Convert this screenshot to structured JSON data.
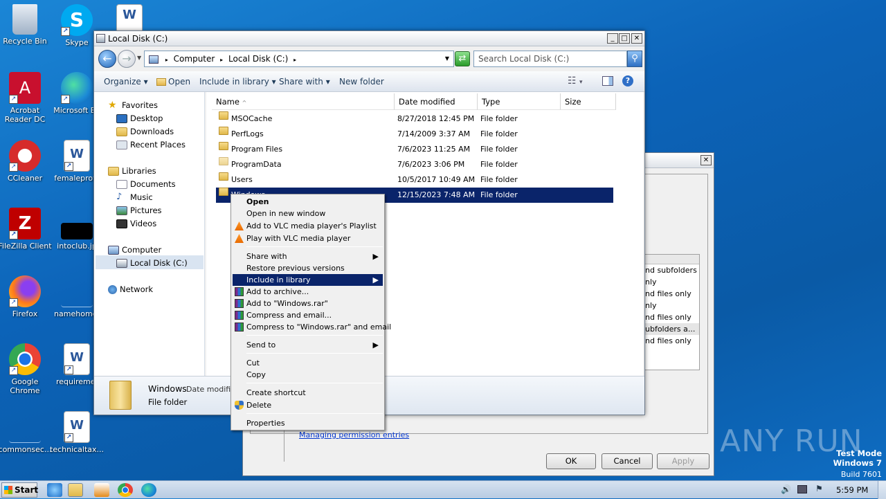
{
  "desktop": {
    "icons": [
      {
        "label": "Recycle Bin"
      },
      {
        "label": "Skype"
      },
      {
        "label": "Acrobat Reader DC"
      },
      {
        "label": "Microsoft Ed"
      },
      {
        "label": "CCleaner"
      },
      {
        "label": "femaleprovi"
      },
      {
        "label": "FileZilla Client"
      },
      {
        "label": "intoclub.jp"
      },
      {
        "label": "Firefox"
      },
      {
        "label": "namehome."
      },
      {
        "label": "Google Chrome"
      },
      {
        "label": "requireme."
      },
      {
        "label": "commonsec..."
      },
      {
        "label": "technicaltax..."
      }
    ]
  },
  "explorer": {
    "title": "Local Disk (C:)",
    "breadcrumb": [
      "Computer",
      "Local Disk (C:)"
    ],
    "search_placeholder": "Search Local Disk (C:)",
    "toolbar": {
      "organize": "Organize",
      "open": "Open",
      "include": "Include in library",
      "share": "Share with",
      "new_folder": "New folder"
    },
    "nav": {
      "favorites": "Favorites",
      "desktop": "Desktop",
      "downloads": "Downloads",
      "recent": "Recent Places",
      "libraries": "Libraries",
      "documents": "Documents",
      "music": "Music",
      "pictures": "Pictures",
      "videos": "Videos",
      "computer": "Computer",
      "local_disk": "Local Disk (C:)",
      "network": "Network"
    },
    "columns": {
      "name": "Name",
      "date": "Date modified",
      "type": "Type",
      "size": "Size"
    },
    "rows": [
      {
        "name": "MSOCache",
        "date": "8/27/2018 12:45 PM",
        "type": "File folder"
      },
      {
        "name": "PerfLogs",
        "date": "7/14/2009 3:37 AM",
        "type": "File folder"
      },
      {
        "name": "Program Files",
        "date": "7/6/2023 11:25 AM",
        "type": "File folder"
      },
      {
        "name": "ProgramData",
        "date": "7/6/2023 3:06 PM",
        "type": "File folder"
      },
      {
        "name": "Users",
        "date": "10/5/2017 10:49 AM",
        "type": "File folder"
      },
      {
        "name": "Windows",
        "date": "12/15/2023 7:48 AM",
        "type": "File folder"
      }
    ],
    "details": {
      "name": "Windows",
      "date_label": "Date modified",
      "type": "File folder"
    }
  },
  "context_menu": {
    "open": "Open",
    "open_new": "Open in new window",
    "vlc_add": "Add to VLC media player's Playlist",
    "vlc_play": "Play with VLC media player",
    "share": "Share with",
    "restore": "Restore previous versions",
    "include": "Include in library",
    "add_archive": "Add to archive...",
    "add_rar": "Add to \"Windows.rar\"",
    "compress_email": "Compress and email...",
    "compress_rar_email": "Compress to \"Windows.rar\" and email",
    "send_to": "Send to",
    "cut": "Cut",
    "copy": "Copy",
    "shortcut": "Create shortcut",
    "delete": "Delete",
    "properties": "Properties"
  },
  "bg_dialog": {
    "items": [
      "nd subfolders",
      "nly",
      "nd files only",
      "nly",
      "nd files only",
      "ubfolders a...",
      "nd files only"
    ],
    "link_text": "Managing permission entries",
    "ok": "OK",
    "cancel": "Cancel",
    "apply": "Apply"
  },
  "watermark": {
    "brand": "ANY RUN",
    "mode": "Test Mode",
    "os": "Windows 7",
    "build": "Build 7601"
  },
  "taskbar": {
    "start": "Start",
    "clock": "5:59 PM"
  }
}
